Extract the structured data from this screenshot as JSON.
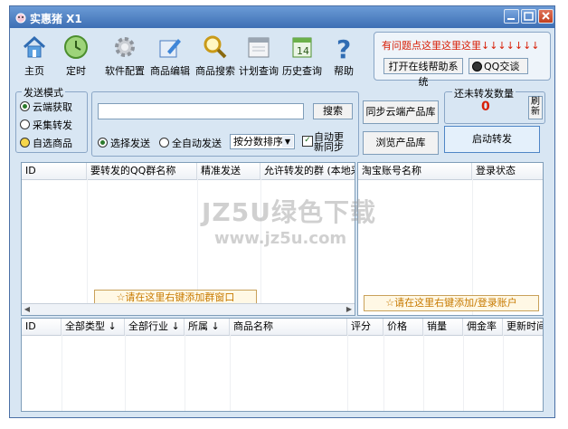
{
  "window": {
    "title": "实惠猪 X1"
  },
  "toolbar": {
    "items": [
      {
        "label": "主页",
        "icon": "home-icon"
      },
      {
        "label": "定时",
        "icon": "clock-icon"
      },
      {
        "label": "软件配置",
        "icon": "gear-icon"
      },
      {
        "label": "商品编辑",
        "icon": "edit-icon"
      },
      {
        "label": "商品搜索",
        "icon": "search-icon"
      },
      {
        "label": "计划查询",
        "icon": "calendar-icon"
      },
      {
        "label": "历史查询",
        "icon": "history-icon"
      },
      {
        "label": "帮助",
        "icon": "help-icon"
      }
    ]
  },
  "help_panel": {
    "text": "有问题点这里这里这里↓↓↓↓↓↓↓",
    "online_help_button": "打开在线帮助系统",
    "qq_button": "QQ交谈"
  },
  "send_mode": {
    "legend": "发送模式",
    "options": [
      "云端获取",
      "采集转发",
      "自选商品"
    ],
    "selected": "云端获取"
  },
  "search": {
    "value": "",
    "button": "搜索"
  },
  "send_options": {
    "select_send": "选择发送",
    "auto_send": "全自动发送",
    "sort_value": "按分数排序",
    "auto_update_line1": "自动更",
    "auto_update_line2": "新同步",
    "auto_update_checked": true
  },
  "actions": {
    "sync_cloud": "同步云端产品库",
    "browse": "浏览产品库",
    "start": "启动转发"
  },
  "unsent_count": {
    "label": "还未转发数量",
    "value": "0",
    "refresh": "刷新"
  },
  "group_grid": {
    "columns": [
      "ID",
      "要转发的QQ群名称",
      "精准发送",
      "允许转发的群 (本地采"
    ],
    "hint": "☆请在这里右键添加群窗口"
  },
  "account_grid": {
    "columns": [
      "淘宝账号名称",
      "登录状态"
    ],
    "hint": "☆请在这里右键添加/登录账户"
  },
  "product_grid": {
    "columns": [
      "ID",
      "全部类型 ↓",
      "全部行业 ↓",
      "所属 ↓",
      "商品名称",
      "评分",
      "价格",
      "销量",
      "佣金率",
      "更新时间"
    ]
  },
  "watermark": {
    "main": "JZ5U绿色下载",
    "sub": "www.jz5u.com"
  },
  "colors": {
    "accent": "#3d6fb4",
    "alert": "#d81e06",
    "hint": "#c77a00"
  }
}
